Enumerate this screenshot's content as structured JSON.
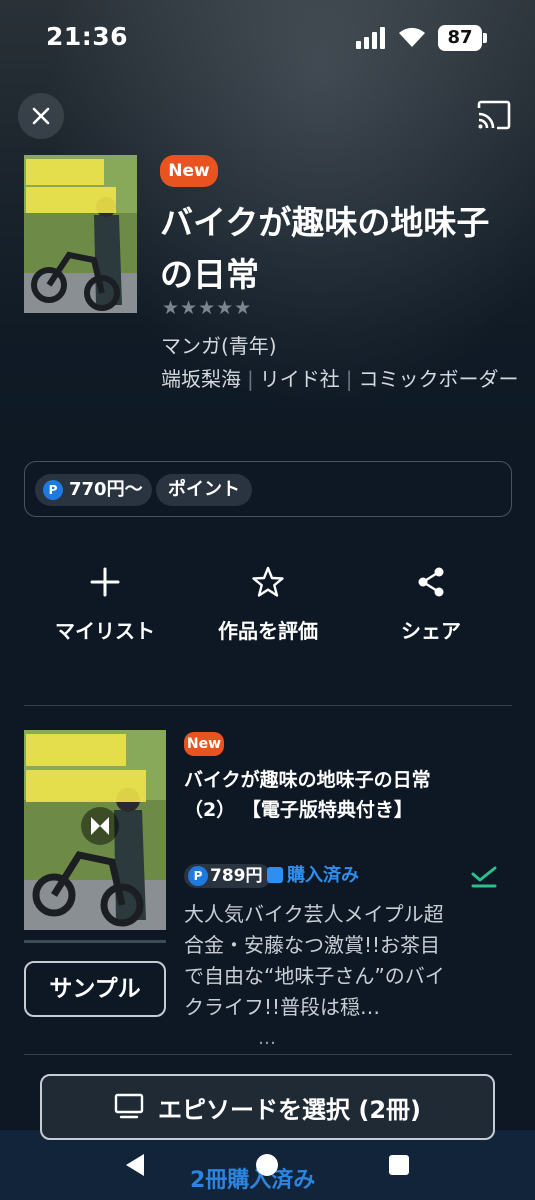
{
  "status_bar": {
    "time": "21:36",
    "battery": "87"
  },
  "header": {
    "close_icon": "close-icon",
    "cast_icon": "cast-icon"
  },
  "book": {
    "badge": "New",
    "title": "バイクが趣味の地味子の日常",
    "rating_stars": "★★★★★",
    "rating_value": 0,
    "genre": "マンガ(青年)",
    "author": "端坂梨海",
    "publisher": "リイド社",
    "label": "コミックボーダー"
  },
  "pricing": {
    "point_icon": "P",
    "price": "770円〜",
    "point_label": "ポイント"
  },
  "actions": [
    {
      "label": "マイリスト",
      "icon": "plus-icon"
    },
    {
      "label": "作品を評価",
      "icon": "star-icon"
    },
    {
      "label": "シェア",
      "icon": "share-icon"
    }
  ],
  "episode": {
    "badge": "New",
    "title": "バイクが趣味の地味子の日常 （2） 【電子版特典付き】",
    "price": "789円",
    "owned_label": "購入済み",
    "description": "大人気バイク芸人メイプル超合金・安藤なつ激賞!!お茶目で自由な“地味子さん”のバイクライフ!!普段は穏…",
    "more": "…",
    "sample_label": "サンプル",
    "read_progress": 1.0
  },
  "footer": {
    "select_label": "エピソードを選択 (2冊)",
    "purchased_label": "2冊購入済み"
  },
  "colors": {
    "background": "#0d1824",
    "accent_new": "#e8531f",
    "accent_blue": "#2f8ff0",
    "check_green": "#2bbf8a"
  }
}
